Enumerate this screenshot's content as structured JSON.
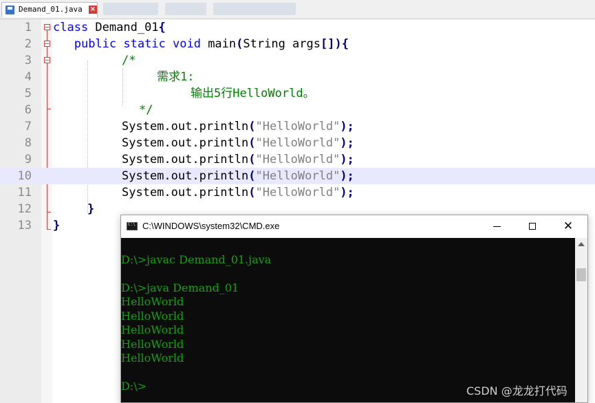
{
  "tab": {
    "label": "Demand_01.java"
  },
  "editor": {
    "current_line": 10,
    "line_numbers": [
      "1",
      "2",
      "3",
      "4",
      "5",
      "6",
      "7",
      "8",
      "9",
      "10",
      "11",
      "12",
      "13"
    ],
    "code": {
      "l1": {
        "kw": "class",
        "rest": " Demand_01",
        "brace": "{"
      },
      "l2": {
        "indent": "   ",
        "kw": "public static void",
        "rest": " main",
        "p1": "(",
        "mid": "String args",
        "p2": "[])",
        "brace": "{"
      },
      "l3": "/*",
      "l4": "需求1:",
      "l5": "输出5行HelloWorld。",
      "l6": "*/",
      "stmt_prefix": "System.out.println",
      "open_paren": "(",
      "string": "\"HelloWorld\"",
      "close": ");",
      "l12": "}",
      "l13": "}"
    }
  },
  "cmd": {
    "title": "C:\\WINDOWS\\system32\\CMD.exe",
    "lines": [
      "",
      "D:\\>javac Demand_01.java",
      "",
      "D:\\>java Demand_01",
      "HelloWorld",
      "HelloWorld",
      "HelloWorld",
      "HelloWorld",
      "HelloWorld",
      "",
      "D:\\>"
    ]
  },
  "watermark": "CSDN @龙龙打代码",
  "colors": {
    "keyword": "#0000ff",
    "string": "#808080",
    "comment": "#008000",
    "current_line": "#e8e8ff",
    "terminal_text": "#13a10e",
    "terminal_bg": "#0c0c0c"
  }
}
